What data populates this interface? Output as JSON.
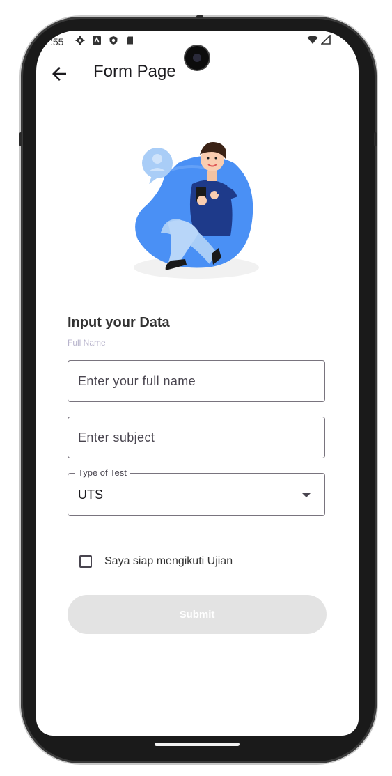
{
  "status_bar": {
    "time": ":55",
    "icons": [
      "gear-icon",
      "a-icon",
      "shield-icon",
      "sd-card-icon"
    ],
    "right_icons": [
      "wifi-icon",
      "signal-icon"
    ]
  },
  "app_bar": {
    "back_icon": "arrow-left-icon",
    "title": "Form Page"
  },
  "form": {
    "title": "Input your Data",
    "caption": "Full Name",
    "full_name": {
      "value": "",
      "placeholder": "Enter your full name"
    },
    "subject": {
      "value": "",
      "placeholder": "Enter subject"
    },
    "test_type": {
      "label": "Type of Test",
      "selected": "UTS"
    },
    "checkbox": {
      "label": "Saya siap mengikuti Ujian",
      "checked": false
    },
    "submit_label": "Submit"
  },
  "colors": {
    "illustration_blob": "#4a90f5",
    "shirt": "#1e3a8a",
    "submit_disabled": "#e3e3e3",
    "caption": "#b8b4cc"
  }
}
